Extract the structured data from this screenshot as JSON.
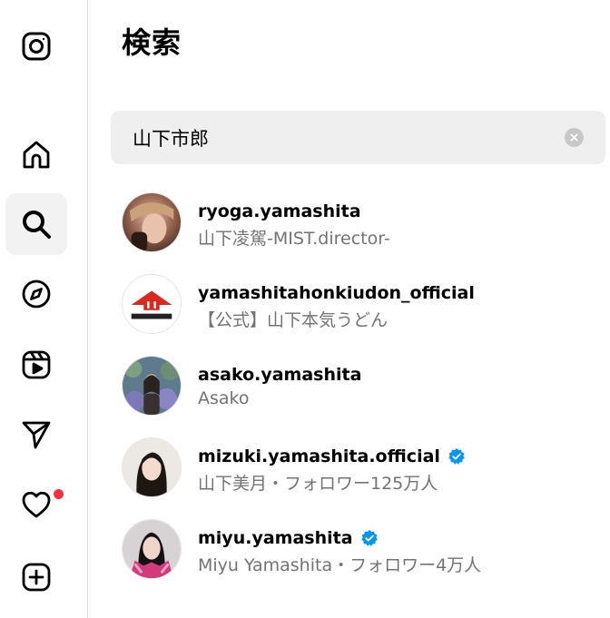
{
  "header": {
    "title": "検索"
  },
  "search": {
    "value": "山下市郎",
    "placeholder": ""
  },
  "sidebar": {
    "items": [
      {
        "icon": "instagram-logo-icon"
      },
      {
        "icon": "home-icon"
      },
      {
        "icon": "search-icon",
        "active": true
      },
      {
        "icon": "explore-compass-icon"
      },
      {
        "icon": "reels-icon"
      },
      {
        "icon": "messages-send-icon"
      },
      {
        "icon": "notifications-heart-icon",
        "badge": true
      },
      {
        "icon": "create-plus-icon"
      }
    ]
  },
  "results": [
    {
      "username": "ryoga.yamashita",
      "subtitle": "山下凌駕-MIST.director-",
      "verified": false
    },
    {
      "username": "yamashitahonkiudon_official",
      "subtitle": "【公式】山下本気うどん",
      "verified": false
    },
    {
      "username": "asako.yamashita",
      "subtitle": "Asako",
      "verified": false
    },
    {
      "username": "mizuki.yamashita.official",
      "subtitle": "山下美月・フォロワー125万人",
      "verified": true
    },
    {
      "username": "miyu.yamashita",
      "subtitle": "Miyu Yamashita・フォロワー4万人",
      "verified": true
    }
  ],
  "colors": {
    "verified": "#0095f6",
    "badge": "#ff3040",
    "search_bg": "#efefef",
    "secondary_text": "#737373"
  }
}
